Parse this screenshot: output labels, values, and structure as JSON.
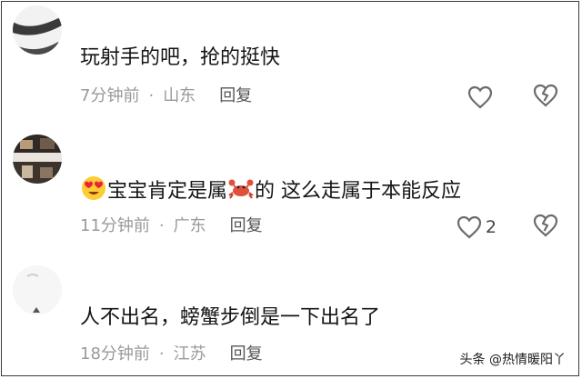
{
  "comments": [
    {
      "text": "玩射手的吧，抢的挺快",
      "time": "7分钟前",
      "location": "山东",
      "reply_label": "回复",
      "like_count": ""
    },
    {
      "prefix_emoji": "heart-eyes-emoji",
      "text_a": "宝宝肯定是属",
      "inline_emoji": "crab-emoji",
      "text_b": "的 这么走属于本能反应",
      "time": "11分钟前",
      "location": "广东",
      "reply_label": "回复",
      "like_count": "2"
    },
    {
      "text": "人不出名，螃蟹步倒是一下出名了",
      "time": "18分钟前",
      "location": "江苏",
      "reply_label": "回复",
      "like_count": ""
    }
  ],
  "separator": "·",
  "watermark": "头条 @热情暖阳丫",
  "colors": {
    "meta": "#9a9a9a",
    "text": "#141414",
    "icon": "#6b6b6b"
  }
}
